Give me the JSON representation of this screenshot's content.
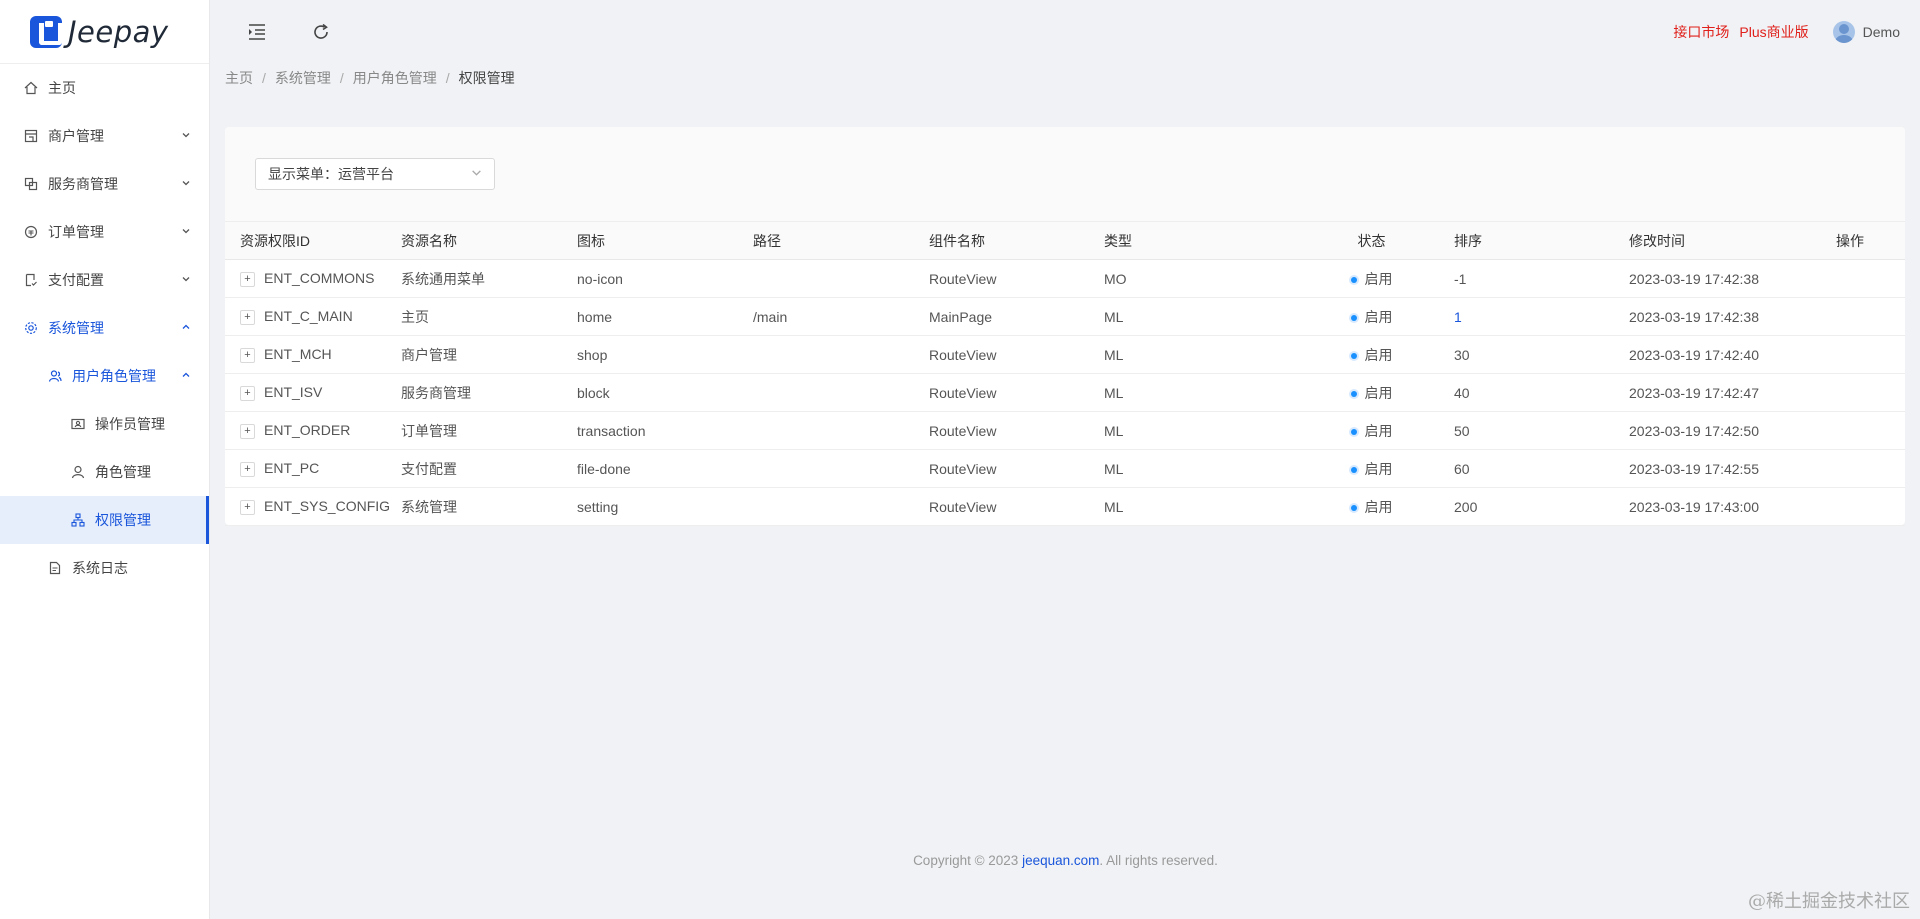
{
  "app": {
    "logo_text": "Jeepay"
  },
  "sidebar": {
    "items": [
      {
        "label": "主页",
        "icon": "home-icon"
      },
      {
        "label": "商户管理",
        "icon": "shop-icon"
      },
      {
        "label": "服务商管理",
        "icon": "block-icon"
      },
      {
        "label": "订单管理",
        "icon": "transaction-icon"
      },
      {
        "label": "支付配置",
        "icon": "file-done-icon"
      },
      {
        "label": "系统管理",
        "icon": "setting-icon"
      },
      {
        "label": "用户角色管理",
        "icon": "team-icon"
      },
      {
        "label": "操作员管理",
        "icon": "contacts-icon"
      },
      {
        "label": "角色管理",
        "icon": "user-icon"
      },
      {
        "label": "权限管理",
        "icon": "apartment-icon"
      },
      {
        "label": "系统日志",
        "icon": "file-text-icon"
      }
    ]
  },
  "header": {
    "link1": "接口市场",
    "link2": "Plus商业版",
    "user": "Demo"
  },
  "breadcrumb": [
    "主页",
    "系统管理",
    "用户角色管理",
    "权限管理"
  ],
  "filter": {
    "label": "显示菜单：运营平台"
  },
  "table": {
    "columns": [
      "资源权限ID",
      "资源名称",
      "图标",
      "路径",
      "组件名称",
      "类型",
      "状态",
      "排序",
      "修改时间",
      "操作"
    ],
    "rows": [
      [
        "ENT_COMMONS",
        "系统通用菜单",
        "no-icon",
        "",
        "RouteView",
        "MO",
        "启用",
        "-1",
        "2023-03-19 17:42:38"
      ],
      [
        "ENT_C_MAIN",
        "主页",
        "home",
        "/main",
        "MainPage",
        "ML",
        "启用",
        "1",
        "2023-03-19 17:42:38"
      ],
      [
        "ENT_MCH",
        "商户管理",
        "shop",
        "",
        "RouteView",
        "ML",
        "启用",
        "30",
        "2023-03-19 17:42:40"
      ],
      [
        "ENT_ISV",
        "服务商管理",
        "block",
        "",
        "RouteView",
        "ML",
        "启用",
        "40",
        "2023-03-19 17:42:47"
      ],
      [
        "ENT_ORDER",
        "订单管理",
        "transaction",
        "",
        "RouteView",
        "ML",
        "启用",
        "50",
        "2023-03-19 17:42:50"
      ],
      [
        "ENT_PC",
        "支付配置",
        "file-done",
        "",
        "RouteView",
        "ML",
        "启用",
        "60",
        "2023-03-19 17:42:55"
      ],
      [
        "ENT_SYS_CONFIG",
        "系统管理",
        "setting",
        "",
        "RouteView",
        "ML",
        "启用",
        "200",
        "2023-03-19 17:43:00"
      ]
    ]
  },
  "footer": {
    "prefix": "Copyright © 2023 ",
    "link": "jeequan.com",
    "suffix": ". All rights reserved."
  },
  "watermark": "@稀土掘金技术社区"
}
